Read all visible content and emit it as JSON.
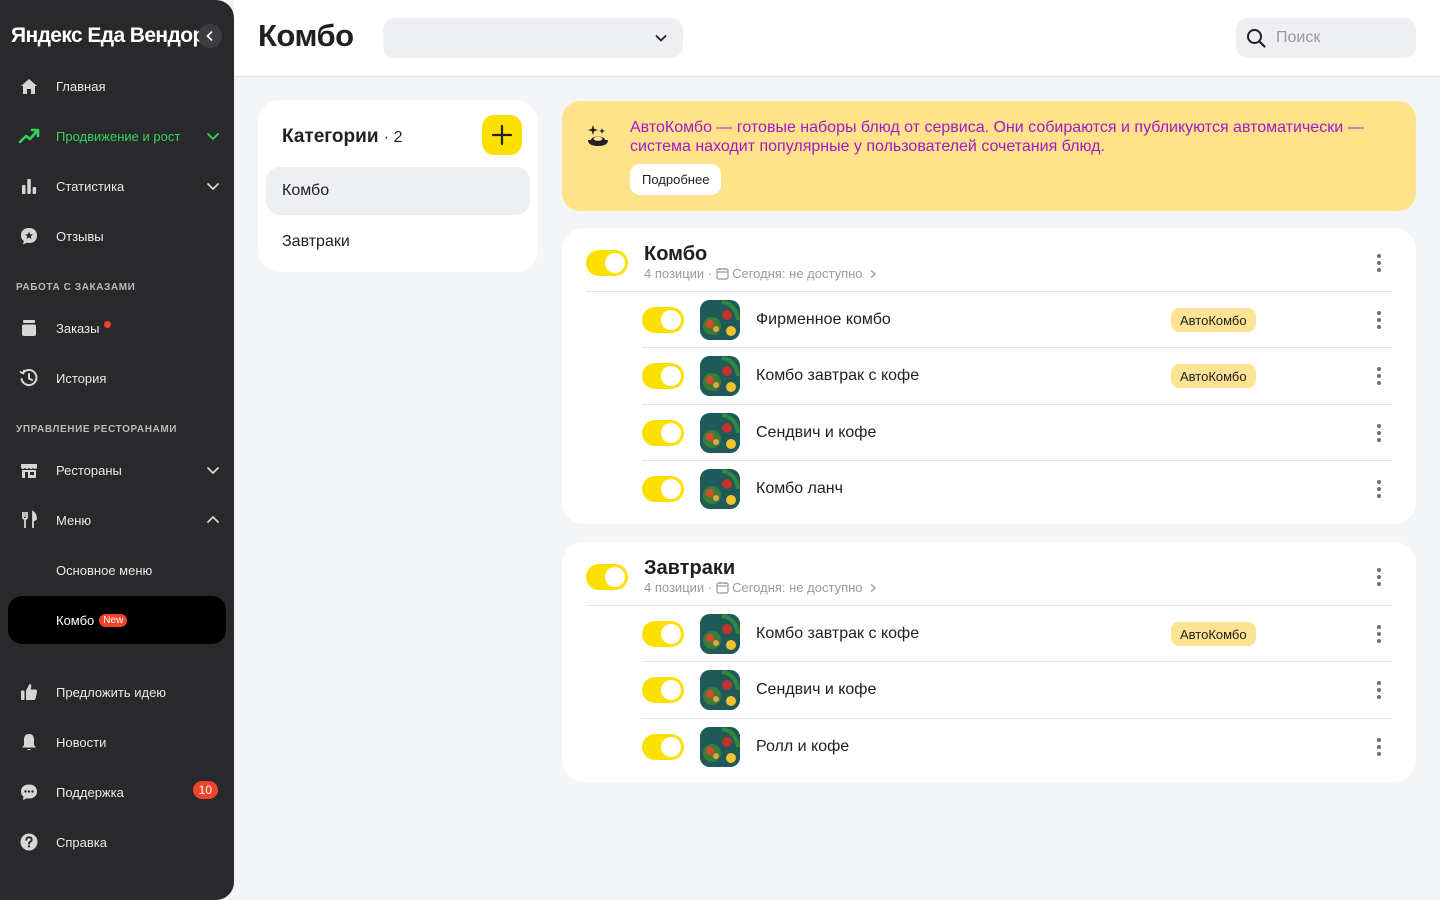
{
  "sidebar": {
    "brand": "Яндекс Еда Вендор",
    "items": {
      "home": "Главная",
      "promotion": "Продвижение и рост",
      "stats": "Статистика",
      "reviews": "Отзывы",
      "orders": "Заказы",
      "history": "История",
      "restaurants": "Рестораны",
      "menu": "Меню",
      "main_menu": "Основное меню",
      "combo": "Комбо",
      "idea": "Предложить идею",
      "news": "Новости",
      "support": "Поддержка",
      "help": "Справка"
    },
    "sections": {
      "orders_work": "РАБОТА С ЗАКАЗАМИ",
      "restaurant_mgmt": "УПРАВЛЕНИЕ РЕСТОРАНАМИ"
    },
    "badge_new": "New",
    "support_count": "10"
  },
  "header": {
    "title": "Комбо",
    "select_value": "",
    "search_placeholder": "Поиск"
  },
  "categories": {
    "title": "Категории",
    "count": "· 2",
    "items": [
      "Комбо",
      "Завтраки"
    ]
  },
  "banner": {
    "text": "АвтоКомбо — готовые наборы блюд от сервиса. Они собираются и публикуются автоматически — система находит популярные у пользователей сочетания блюд.",
    "button": "Подробнее"
  },
  "auto_badge": "АвтоКомбо",
  "groups": [
    {
      "name": "Комбо",
      "positions": "4 позиции ·",
      "availability": "Сегодня: не доступно",
      "items": [
        {
          "name": "Фирменное комбо",
          "auto": true
        },
        {
          "name": "Комбо завтрак с кофе",
          "auto": true
        },
        {
          "name": "Сендвич и кофе",
          "auto": false
        },
        {
          "name": "Комбо ланч",
          "auto": false
        }
      ]
    },
    {
      "name": "Завтраки",
      "positions": "4 позиции ·",
      "availability": "Сегодня: не доступно",
      "items": [
        {
          "name": "Комбо завтрак с кофе",
          "auto": true
        },
        {
          "name": "Сендвич и кофе",
          "auto": false
        },
        {
          "name": "Ролл и кофе",
          "auto": false
        }
      ]
    }
  ],
  "colors": {
    "accent_yellow": "#fce000",
    "promo_green": "#35d35a",
    "banner_bg": "#ffe28a",
    "banner_text": "#a419c9",
    "badge_red": "#f5432b"
  }
}
